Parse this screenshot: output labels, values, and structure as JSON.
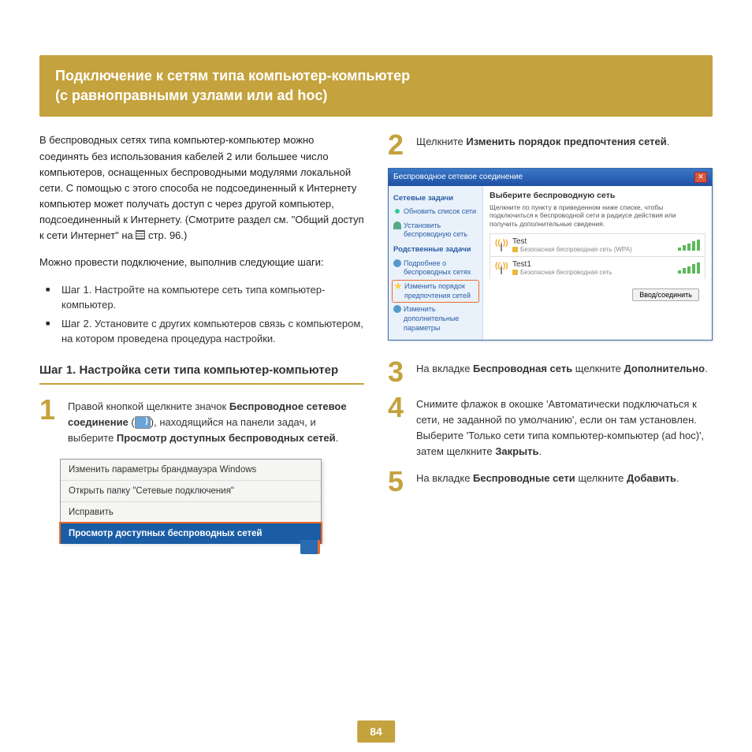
{
  "banner": {
    "line1": "Подключение к сетям типа компьютер-компьютер",
    "line2": "(с равноправными узлами или ad hoc)"
  },
  "left": {
    "intro": "В беспроводных сетях типа компьютер-компьютер можно соединять без использования кабелей 2 или большее число компьютеров, оснащенных беспроводными модулями локальной сети. С помощью с этого способа не подсоединенный к Интернету компьютер может получать доступ с через другой компьютер, подсоединенный к Интернету. (Смотрите раздел см. \"Общий доступ к сети Интернет\" на ",
    "intro_pageref": "стр. 96.)",
    "para2": "Можно провести подключение, выполнив следующие шаги:",
    "bullets": [
      "Шаг 1. Настройте на компьютере сеть типа компьютер-компьютер.",
      "Шаг 2. Установите с других компьютеров связь с компьютером, на котором проведена процедура настройки."
    ],
    "step1_title": "Шаг 1. Настройка сети типа компьютер-компьютер",
    "num1_pre": "Правой кнопкой щелкните значок ",
    "num1_b1": "Беспроводное сетевое соединение",
    "num1_mid": " (",
    "num1_mid2": "), находящийся на панели задач, и выберите ",
    "num1_b2": "Просмотр доступных беспроводных сетей",
    "num1_end": ".",
    "ctx": {
      "i1": "Изменить параметры брандмауэра Windows",
      "i2": "Открыть папку \"Сетевые подключения\"",
      "i3": "Исправить",
      "i4": "Просмотр доступных беспроводных сетей"
    }
  },
  "right": {
    "n2_pre": "Щелкните ",
    "n2_b": "Изменить порядок предпочтения сетей",
    "n2_end": ".",
    "dlg": {
      "title": "Беспроводное сетевое соединение",
      "side_h1": "Сетевые задачи",
      "s_refresh": "Обновить список сети",
      "s_home": "Установить беспроводную сеть",
      "side_h2": "Родственные задачи",
      "s_info": "Подробнее о беспроводных сетях",
      "s_star": "Изменить порядок предпочтения сетей",
      "s_gear": "Изменить дополнительные параметры",
      "main_h": "Выберите беспроводную сеть",
      "main_sub": "Щелкните по пункту в приведенном ниже списке, чтобы подключиться к беспроводной сети в радиусе действия или получить дополнительные сведения.",
      "net1_name": "Test",
      "net1_sec": "Безопасная беспроводная сеть (WPA)",
      "net2_name": "Test1",
      "net2_sec": "Безопасная беспроводная сеть",
      "connect": "Ввод/соединить"
    },
    "n3_pre": "На вкладке ",
    "n3_b1": "Беспроводная сеть",
    "n3_mid": " щелкните ",
    "n3_b2": "Дополнительно",
    "n3_end": ".",
    "n4_text": "Снимите флажок в окошке 'Автоматически подключаться к сети, не заданной по умолчанию', если он там установлен. Выберите 'Только сети типа компьютер-компьютер (ad hoc)', затем щелкните ",
    "n4_b": "Закрыть",
    "n4_end": ".",
    "n5_pre": "На вкладке ",
    "n5_b1": "Беспроводные сети",
    "n5_mid": " щелкните ",
    "n5_b2": "Добавить",
    "n5_end": "."
  },
  "page_number": "84"
}
